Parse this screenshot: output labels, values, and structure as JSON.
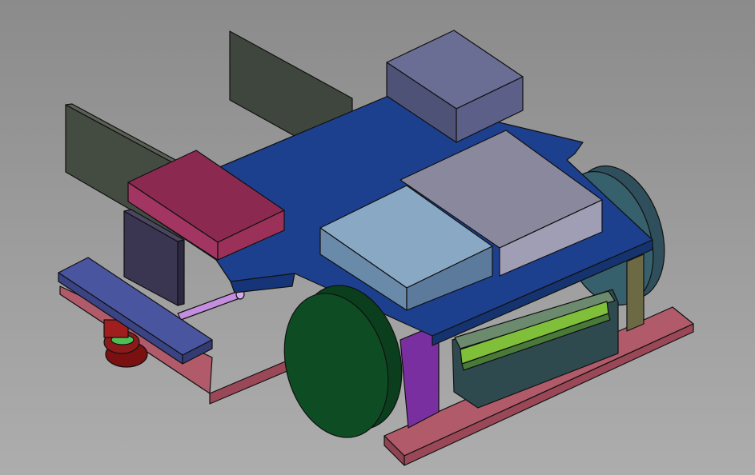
{
  "viewport": {
    "background_top": "#8b8b8b",
    "background_bottom": "#adadad"
  },
  "model": {
    "name": "",
    "parts": [
      {
        "id": "upright-back-left",
        "color": "#3f463d"
      },
      {
        "id": "upright-back-right",
        "color": "#3f463d"
      },
      {
        "id": "top-plate",
        "color": "#1c3f8e"
      },
      {
        "id": "camera-box",
        "color": "#585c80"
      },
      {
        "id": "pink-module",
        "color": "#8b2950"
      },
      {
        "id": "light-blue-module",
        "color": "#5c7a9c"
      },
      {
        "id": "gray-module",
        "color": "#9c9ab0"
      },
      {
        "id": "dark-block",
        "color": "#3a3550"
      },
      {
        "id": "bottom-frame-rail",
        "color": "#b05a6a"
      },
      {
        "id": "left-bumper-bar",
        "color": "#46508f"
      },
      {
        "id": "axle-rod",
        "color": "#c48de0"
      },
      {
        "id": "front-wheel",
        "color": "#0e4d23"
      },
      {
        "id": "rear-wheel",
        "color": "#2f4f5c"
      },
      {
        "id": "battery-pack",
        "color": "#2f4a4f"
      },
      {
        "id": "battery-label",
        "color": "#7fbf3a"
      },
      {
        "id": "purple-support",
        "color": "#7a2fa0"
      },
      {
        "id": "olive-post",
        "color": "#6b6a45"
      },
      {
        "id": "red-caster",
        "color": "#7a1010"
      }
    ]
  }
}
